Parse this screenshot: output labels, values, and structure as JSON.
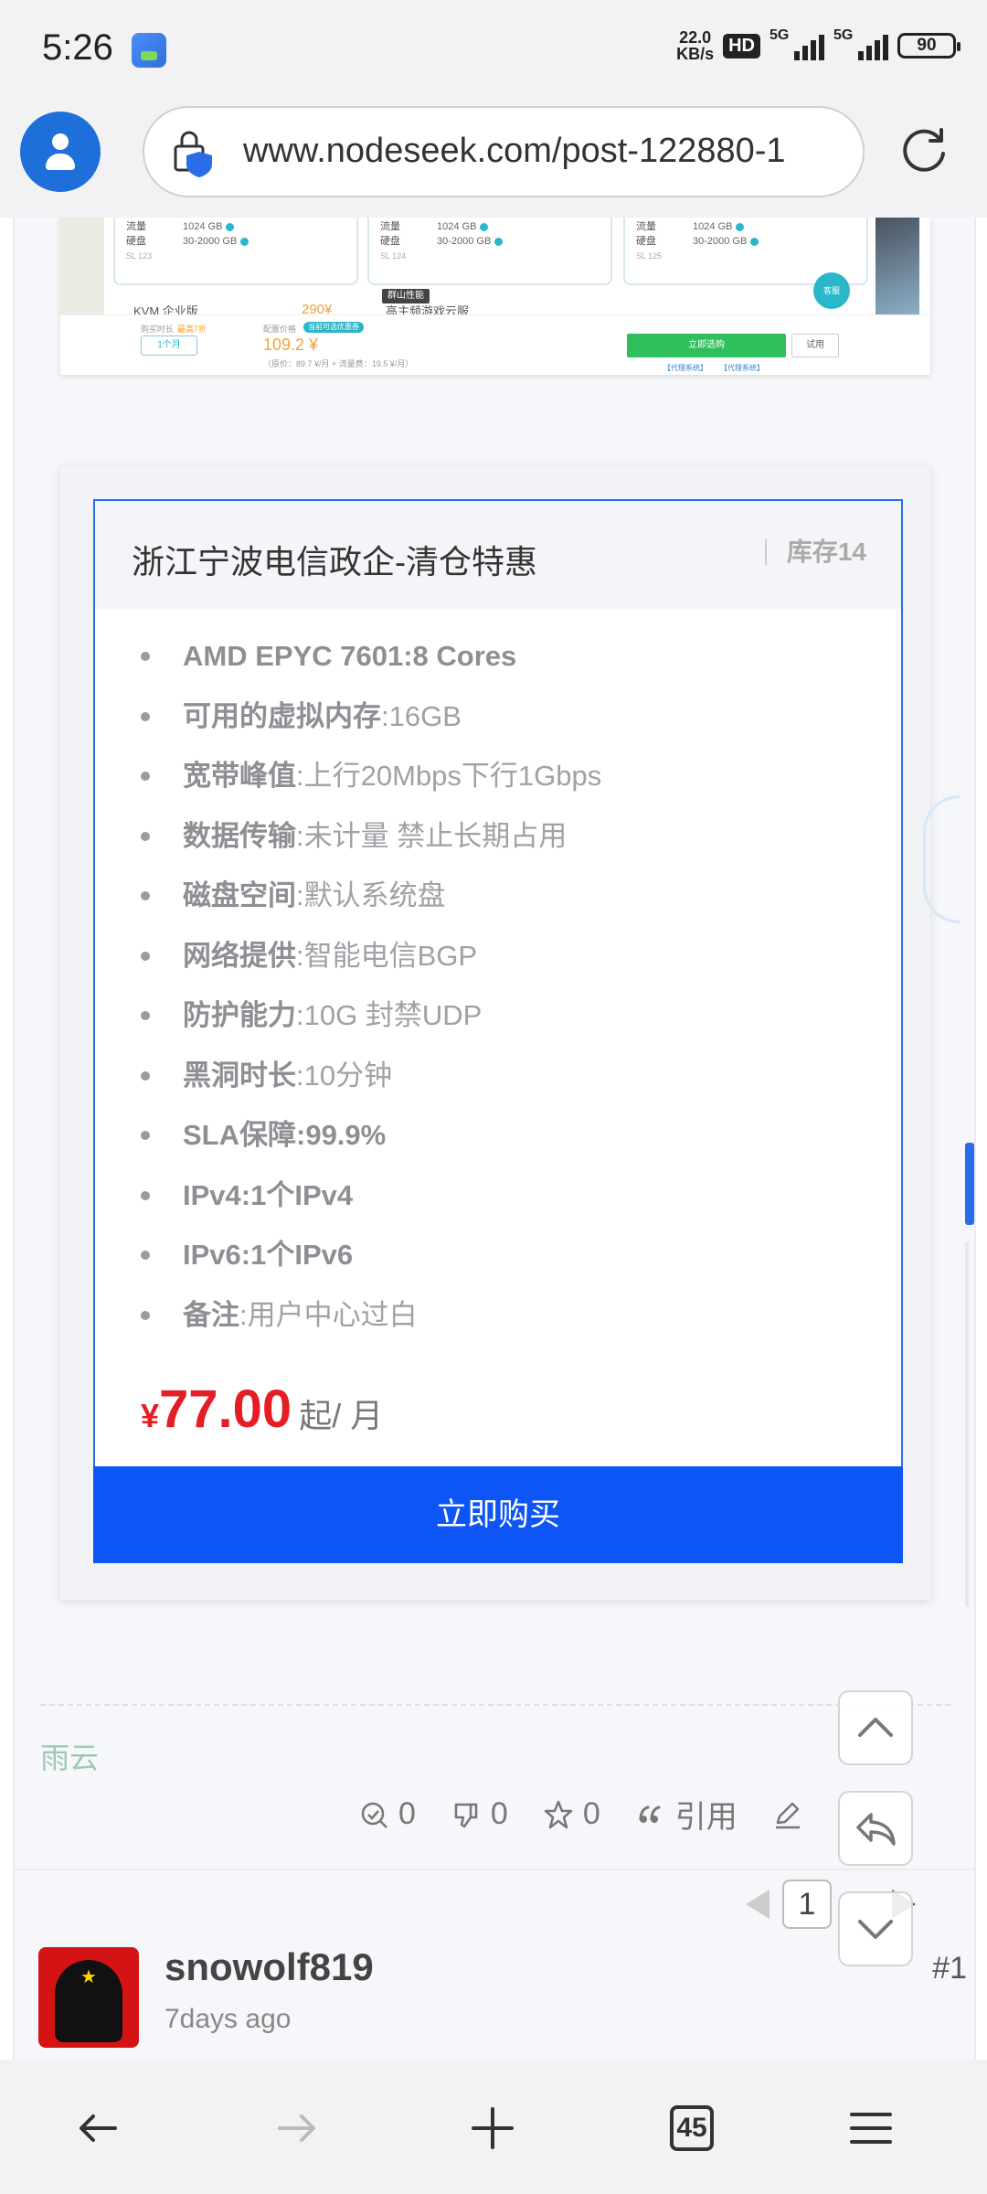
{
  "status_bar": {
    "time": "5:26",
    "net_speed_value": "22.0",
    "net_speed_unit": "KB/s",
    "hd_badge": "HD",
    "signal1_label": "5G",
    "signal2_label": "5G",
    "battery": "90"
  },
  "browser": {
    "url": "www.nodeseek.com/post-122880-1",
    "tab_count": "45"
  },
  "screenshot_top": {
    "cards": [
      {
        "traffic_label": "流量",
        "traffic_value": "1024 GB",
        "disk_label": "硬盘",
        "disk_value": "30-2000 GB",
        "note": "SL 123"
      },
      {
        "traffic_label": "流量",
        "traffic_value": "1024 GB",
        "disk_label": "硬盘",
        "disk_value": "30-2000 GB",
        "note": "SL 124"
      },
      {
        "traffic_label": "流量",
        "traffic_value": "1024 GB",
        "disk_label": "硬盘",
        "disk_value": "30-2000 GB",
        "note": "SL 125"
      }
    ],
    "tag_label": "群山性能",
    "kvm_label": "KVM 企业版",
    "kvm_price": "290¥",
    "card2_sub": "高主频游戏云服",
    "support_label": "客服",
    "footer": {
      "period_label": "购买时长",
      "discount_label": "最高7折",
      "period_value": "1个月",
      "price_label": "配置价格",
      "badge": "当前可选优惠券",
      "price_value": "109.2 ¥",
      "price_note": "（原价：89.7 ¥/月 + 流量费：19.5 ¥/月）",
      "buy_label": "立即选购",
      "trial_label": "试用",
      "link1": "【代理系统】",
      "link2": "【代理系统】"
    }
  },
  "product": {
    "title": "浙江宁波电信政企-清仓特惠",
    "stock": "库存14",
    "specs": [
      {
        "key": "",
        "value": "AMD EPYC 7601:8 Cores"
      },
      {
        "key": "可用的虚拟内存",
        "value": ":16GB"
      },
      {
        "key": "宽带峰值",
        "value": ":上行20Mbps下行1Gbps"
      },
      {
        "key": "数据传输",
        "value": ":未计量 禁止长期占用"
      },
      {
        "key": "磁盘空间",
        "value": ":默认系统盘"
      },
      {
        "key": "网络提供",
        "value": ":智能电信BGP"
      },
      {
        "key": "防护能力",
        "value": ":10G 封禁UDP"
      },
      {
        "key": "黑洞时长",
        "value": ":10分钟"
      },
      {
        "key": "SLA保障",
        "value": ":99.9%"
      },
      {
        "key": "",
        "value": "IPv4:1个IPv4"
      },
      {
        "key": "",
        "value": "IPv6:1个IPv6"
      },
      {
        "key": "备注",
        "value": ":用户中心过白"
      }
    ],
    "price_currency": "¥",
    "price_amount": "77.00",
    "price_unit": "起/ 月",
    "buy_label": "立即购买"
  },
  "post": {
    "signature": "雨云",
    "actions": {
      "like_count": "0",
      "dislike_count": "0",
      "star_count": "0",
      "quote_label": "引用"
    },
    "pager": {
      "current_page": "1"
    }
  },
  "next_post": {
    "username": "snowolf819",
    "time": "7days ago",
    "floor": "#1"
  },
  "colors": {
    "accent_blue": "#0d55f5",
    "price_red": "#e51d24",
    "signature_green": "#9fc9b3"
  },
  "icons": [
    "lock-shield-icon",
    "reload-icon",
    "profile-icon",
    "scroll-up-icon",
    "reply-icon",
    "scroll-down-icon",
    "back-icon",
    "forward-icon",
    "new-tab-icon",
    "menu-icon"
  ]
}
